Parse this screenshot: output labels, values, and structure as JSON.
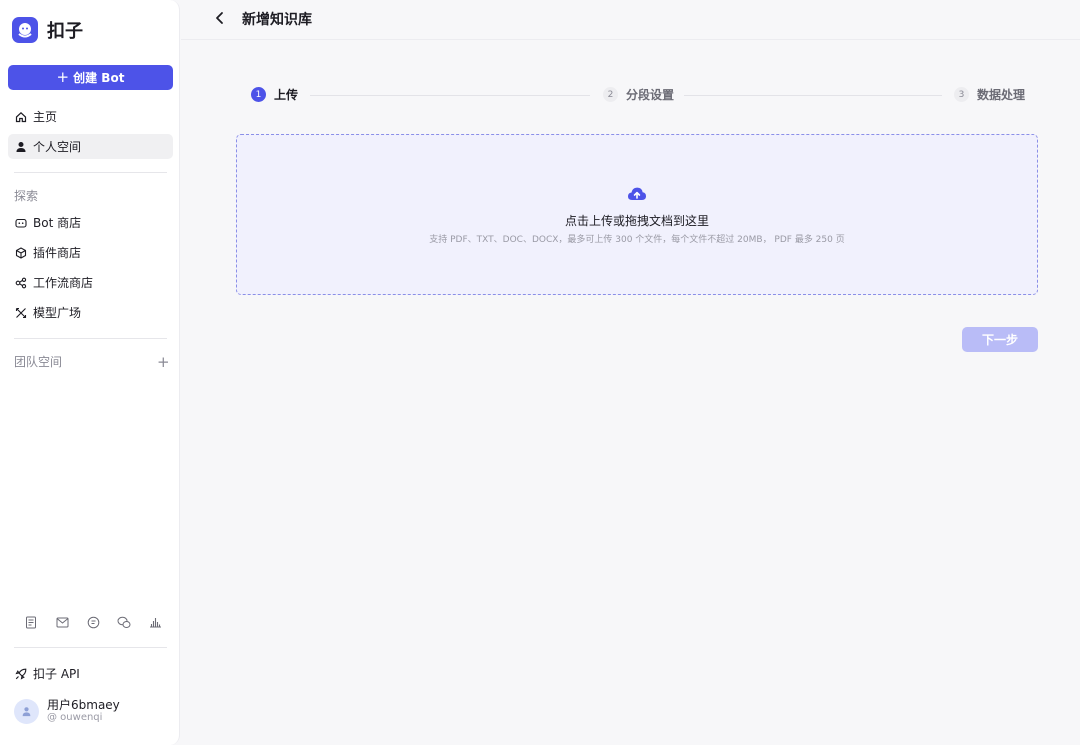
{
  "app": {
    "name": "扣子"
  },
  "sidebar": {
    "create_button": "创建 Bot",
    "nav": [
      {
        "label": "主页",
        "icon": "home-icon"
      },
      {
        "label": "个人空间",
        "icon": "person-icon",
        "active": true
      }
    ],
    "explore_label": "探索",
    "explore": [
      {
        "label": "Bot 商店",
        "icon": "bot-icon"
      },
      {
        "label": "插件商店",
        "icon": "cube-icon"
      },
      {
        "label": "工作流商店",
        "icon": "workflow-icon"
      },
      {
        "label": "模型广场",
        "icon": "model-icon"
      }
    ],
    "team_label": "团队空间",
    "footer_icons": [
      "document-icon",
      "mail-icon",
      "chat-icon",
      "wechat-icon",
      "stats-icon"
    ],
    "api_label": "扣子 API",
    "user": {
      "name": "用户6bmaey",
      "handle": "@ ouwenqi"
    }
  },
  "header": {
    "title": "新增知识库"
  },
  "steps": [
    {
      "num": "1",
      "label": "上传",
      "state": "active"
    },
    {
      "num": "2",
      "label": "分段设置",
      "state": "todo"
    },
    {
      "num": "3",
      "label": "数据处理",
      "state": "todo"
    }
  ],
  "upload": {
    "title": "点击上传或拖拽文档到这里",
    "hint": "支持 PDF、TXT、DOC、DOCX，最多可上传 300 个文件，每个文件不超过 20MB， PDF 最多 250 页"
  },
  "next_button": "下一步",
  "colors": {
    "accent": "#4d53e8",
    "accent_disabled": "#b9bcf7"
  }
}
